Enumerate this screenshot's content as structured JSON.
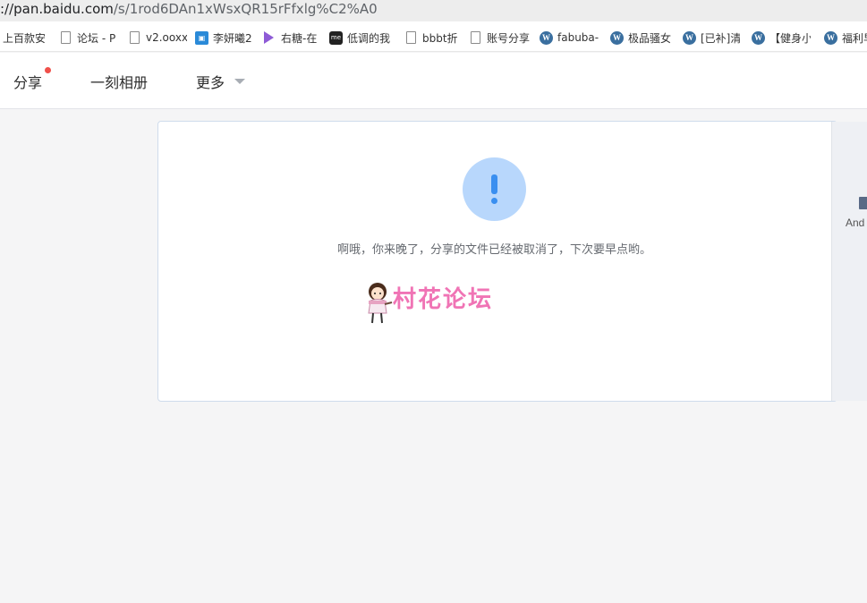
{
  "browser": {
    "url_host": "://pan.baidu.com",
    "url_path": "/s/1rod6DAn1xWsxQR15rFfxlg%C2%A0"
  },
  "bookmarks": [
    {
      "label": "上百款安",
      "icon": "none"
    },
    {
      "label": "论坛 - P",
      "icon": "page-icon"
    },
    {
      "label": "v2.ooxx",
      "icon": "page-icon"
    },
    {
      "label": "李妍曦2",
      "icon": "blue-app-icon"
    },
    {
      "label": "右糖-在",
      "icon": "play-icon"
    },
    {
      "label": "低调的我",
      "icon": "me-icon"
    },
    {
      "label": "bbbt折",
      "icon": "page-icon"
    },
    {
      "label": "账号分享",
      "icon": "page-icon"
    },
    {
      "label": "fabuba-",
      "icon": "wordpress-icon"
    },
    {
      "label": "极品骚女",
      "icon": "wordpress-icon"
    },
    {
      "label": "[已补]清",
      "icon": "wordpress-icon"
    },
    {
      "label": "【健身小",
      "icon": "wordpress-icon"
    },
    {
      "label": "福利早",
      "icon": "wordpress-icon"
    }
  ],
  "nav": {
    "share": "分享",
    "album": "一刻相册",
    "more": "更多"
  },
  "colors": {
    "alert_bg": "#b8d7fc",
    "alert_fg": "#3a8ff0",
    "notification_dot": "#f0504a",
    "watermark": "#f074b5"
  },
  "content": {
    "alert_icon": "exclamation-icon",
    "message": "啊哦，你来晚了，分享的文件已经被取消了，下次要早点哟。",
    "watermark_text": "村花论坛"
  },
  "side": {
    "label": "And"
  }
}
